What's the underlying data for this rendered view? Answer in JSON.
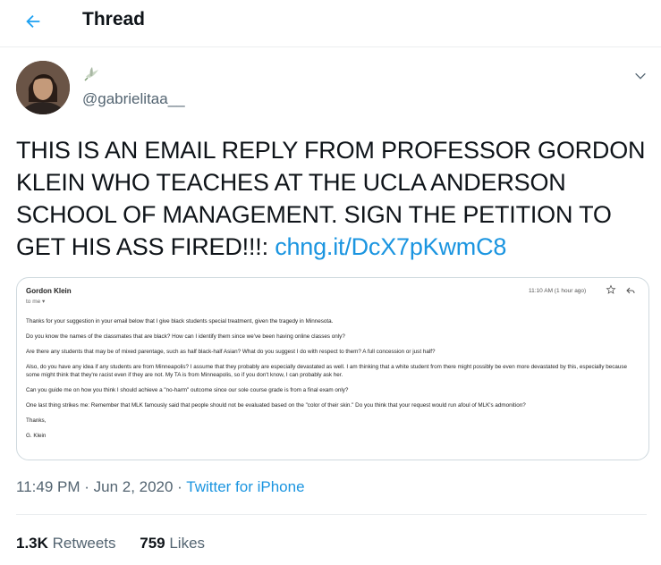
{
  "header": {
    "title": "Thread",
    "back_icon": "arrow-left-icon",
    "accent": "#1da1f2"
  },
  "author": {
    "handle": "@gabrielitaa__",
    "name_icon": "dove-icon"
  },
  "tweet": {
    "text": "THIS IS AN EMAIL REPLY FROM PROFESSOR GORDON KLEIN WHO TEACHES AT THE UCLA ANDERSON SCHOOL OF MANAGEMENT. SIGN THE PETITION TO GET HIS ASS FIRED!!!: ",
    "link": "chng.it/DcX7pKwmC8",
    "link_color": "#1b95e0"
  },
  "email": {
    "sender": "Gordon Klein",
    "to": "to me ▾",
    "time": "11:10 AM (1 hour ago)",
    "paragraphs": [
      "Thanks for your suggestion in your email below that I give black students special treatment, given the tragedy in Minnesota.",
      "Do you know the names of the classmates that are black? How can I identify them since we've been having online classes only?",
      "Are there any students that may be of mixed parentage, such as half black-half Asian? What do you suggest I do with respect to them? A full concession or just half?",
      "Also, do you have any idea if any students are from Minneapolis? I assume that they probably are especially devastated as well. I am thinking that a white student from there might possibly be even more devastated by this, especially because some might think that they're racist even if they are not. My TA is from Minneapolis, so if you don't know, I can probably ask her.",
      "Can you guide me on how you think I should achieve a \"no-harm\" outcome since our sole course grade is from a final exam only?",
      "One last thing strikes me: Remember that MLK famously said that people should not be evaluated based on the \"color of their skin.\" Do you think that your request would run afoul of MLK's admonition?",
      "Thanks,",
      "G. Klein"
    ]
  },
  "meta": {
    "time": "11:49 PM · Jun 2, 2020 · ",
    "source": "Twitter for iPhone"
  },
  "stats": {
    "retweets_count": "1.3K",
    "retweets_label": " Retweets",
    "likes_count": "759",
    "likes_label": " Likes"
  }
}
